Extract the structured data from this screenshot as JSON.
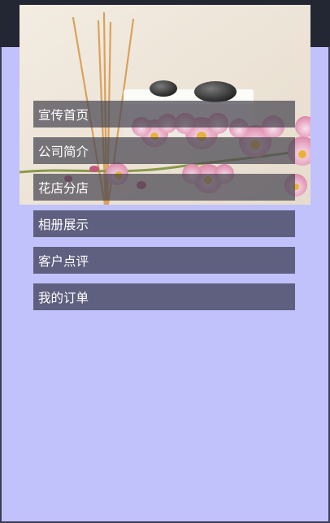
{
  "colors": {
    "page_background": "#c1c2fb",
    "top_bar": "#222733",
    "menu_item_background": "#5f5f80",
    "menu_text": "#ffffff"
  },
  "hero": {
    "icon": "spa-orchid-hero-image"
  },
  "menu": {
    "items": [
      {
        "label": "宣传首页"
      },
      {
        "label": "公司简介"
      },
      {
        "label": "花店分店"
      },
      {
        "label": "相册展示"
      },
      {
        "label": "客户点评"
      },
      {
        "label": "我的订单"
      }
    ]
  }
}
